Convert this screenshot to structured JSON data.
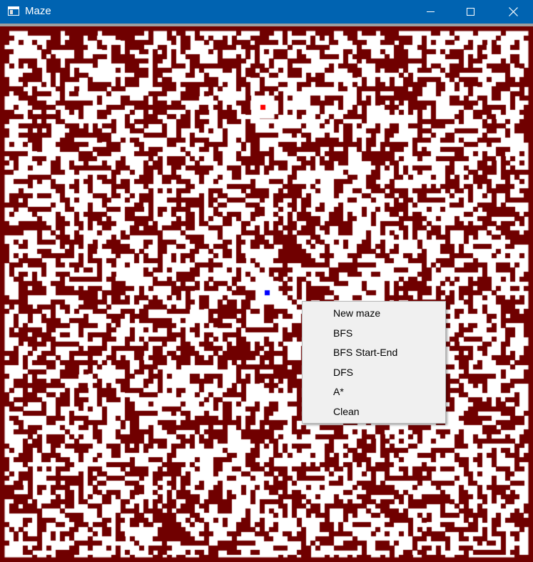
{
  "window": {
    "title": "Maze",
    "icon": "app-window-icon",
    "buttons": {
      "minimize": "minimize-icon",
      "maximize": "maximize-icon",
      "close": "close-icon"
    }
  },
  "maze": {
    "wall_color": "#700000",
    "path_color": "#ffffff",
    "start_color": "#ff0000",
    "end_color": "#0000ff"
  },
  "context_menu": {
    "items": [
      {
        "label": "New maze"
      },
      {
        "label": "BFS"
      },
      {
        "label": "BFS Start-End"
      },
      {
        "label": "DFS"
      },
      {
        "label": "A*"
      },
      {
        "label": "Clean"
      }
    ]
  }
}
